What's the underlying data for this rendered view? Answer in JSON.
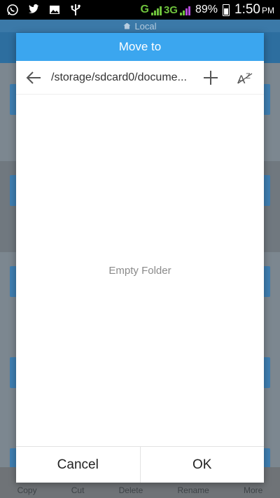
{
  "status_bar": {
    "icons": [
      "whatsapp-icon",
      "twitter-icon",
      "gallery-icon",
      "usb-icon"
    ],
    "network_primary": "G",
    "network_secondary": "3G",
    "battery_percent": "89%",
    "time": "1:50",
    "time_suffix": "PM"
  },
  "background_app": {
    "header_title": "Local",
    "bottom_bar": [
      "Copy",
      "Cut",
      "Delete",
      "Rename",
      "More"
    ]
  },
  "dialog": {
    "title": "Move to",
    "path": "/storage/sdcard0/docume...",
    "empty_message": "Empty Folder",
    "cancel_label": "Cancel",
    "ok_label": "OK"
  },
  "colors": {
    "dialog_title_bg": "#3ba6ef",
    "accent_green": "#6ec23c",
    "app_header_bg": "#2d6e9f"
  }
}
